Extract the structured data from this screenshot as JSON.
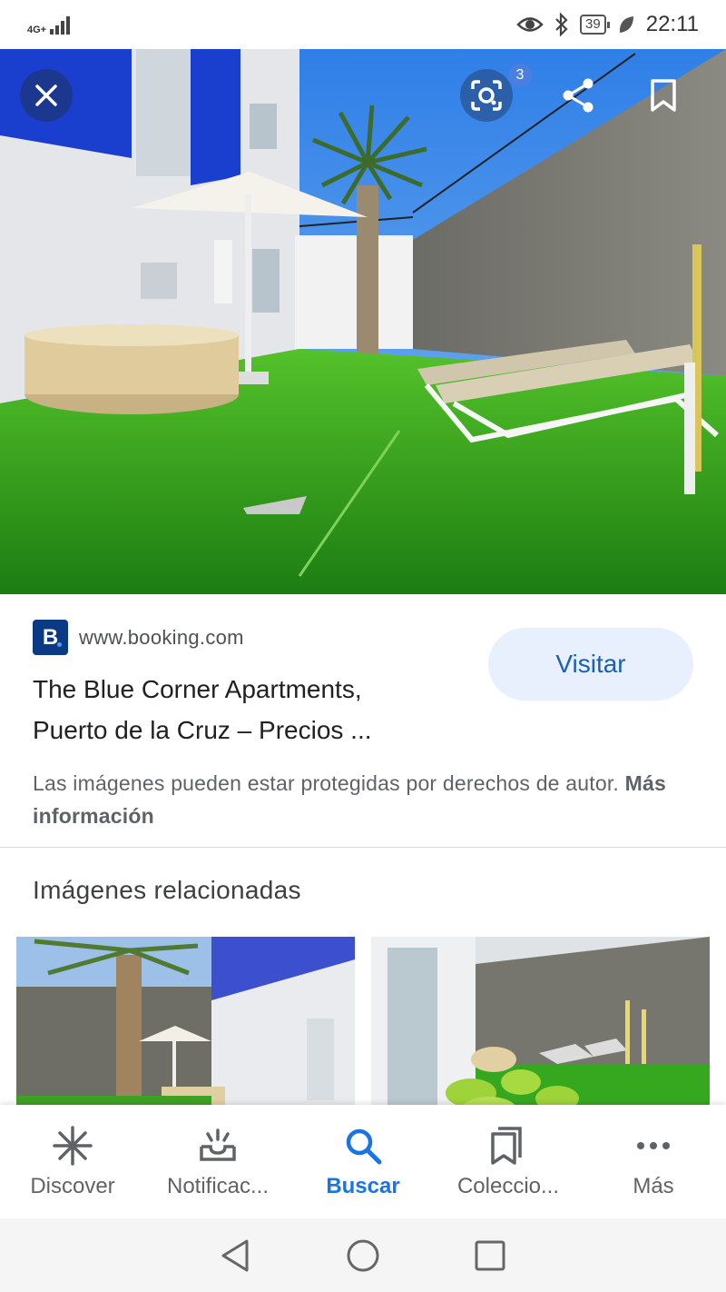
{
  "status_bar": {
    "network": "4G+",
    "battery": "39",
    "time": "22:11"
  },
  "hero": {
    "lens_badge": "3"
  },
  "result": {
    "domain": "www.booking.com",
    "favicon_letter": "B",
    "visit_label": "Visitar",
    "title_line1": "The Blue Corner Apartments,",
    "title_line2": "Puerto de la Cruz – Precios ...",
    "disclaimer": "Las imágenes pueden estar protegidas por derechos de autor.",
    "more_info": "Más información"
  },
  "related": {
    "heading": "Imágenes relacionadas"
  },
  "bottom_nav": {
    "items": [
      {
        "label": "Discover",
        "icon": "asterisk-icon"
      },
      {
        "label": "Notificac...",
        "icon": "inbox-notification-icon"
      },
      {
        "label": "Buscar",
        "icon": "search-icon"
      },
      {
        "label": "Coleccio...",
        "icon": "collections-icon"
      },
      {
        "label": "Más",
        "icon": "more-horiz-icon"
      }
    ]
  },
  "colors": {
    "accent": "#1a73e8",
    "visit_bg": "#e8f0fe",
    "booking_brand": "#0b3a84"
  }
}
